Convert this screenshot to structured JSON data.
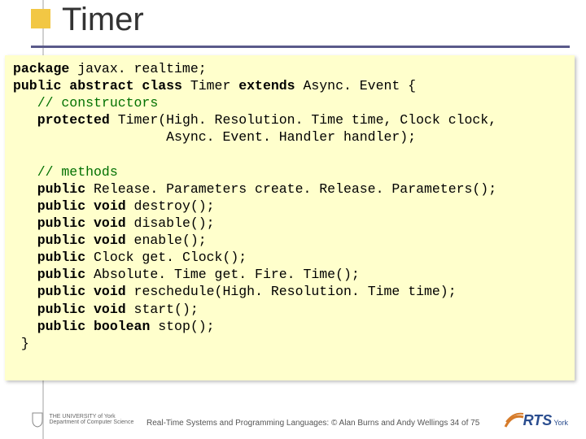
{
  "title": "Timer",
  "code": {
    "l1a": "package",
    "l1b": " javax. realtime;",
    "l2a": "public abstract class",
    "l2b": " Timer ",
    "l2c": "extends",
    "l2d": " Async. Event {",
    "l3": "   // constructors",
    "l4a": "   protected",
    "l4b": " Timer(High. Resolution. Time time, Clock clock,",
    "l5": "                   Async. Event. Handler handler);",
    "blank1": "",
    "l6": "   // methods",
    "l7a": "   public",
    "l7b": " Release. Parameters create. Release. Parameters();",
    "l8a": "   public",
    "l8b": " ",
    "l8c": "void",
    "l8d": " destroy();",
    "l9a": "   public",
    "l9b": " ",
    "l9c": "void",
    "l9d": " disable();",
    "l10a": "   public",
    "l10b": " ",
    "l10c": "void",
    "l10d": " enable();",
    "l11a": "   public",
    "l11b": " Clock get. Clock();",
    "l12a": "   public",
    "l12b": " Absolute. Time get. Fire. Time();",
    "l13a": "   public",
    "l13b": " ",
    "l13c": "void",
    "l13d": " reschedule(High. Resolution. Time time);",
    "l14a": "   public",
    "l14b": " ",
    "l14c": "void",
    "l14d": " start();",
    "l15a": "   public",
    "l15b": " ",
    "l15c": "boolean",
    "l15d": " stop();",
    "l16": " }"
  },
  "footer": {
    "dept_line1": "THE UNIVERSITY of York",
    "dept_line2": "Department of Computer Science",
    "caption": "Real-Time Systems and Programming Languages: © Alan Burns and Andy Wellings 34 of 75",
    "rts": "RTS",
    "rts_sub": "York"
  }
}
